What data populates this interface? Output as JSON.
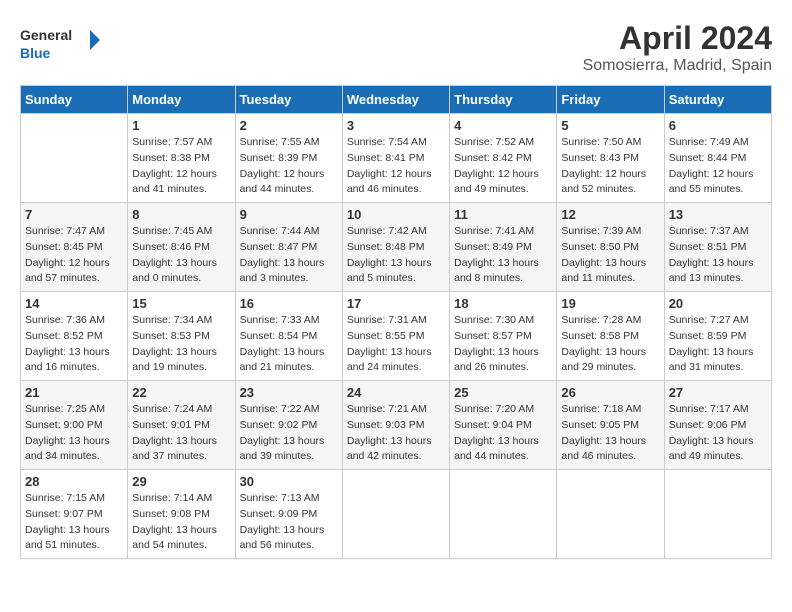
{
  "logo": {
    "line1": "General",
    "line2": "Blue"
  },
  "title": "April 2024",
  "subtitle": "Somosierra, Madrid, Spain",
  "days_of_week": [
    "Sunday",
    "Monday",
    "Tuesday",
    "Wednesday",
    "Thursday",
    "Friday",
    "Saturday"
  ],
  "weeks": [
    [
      {
        "day": "",
        "info": ""
      },
      {
        "day": "1",
        "info": "Sunrise: 7:57 AM\nSunset: 8:38 PM\nDaylight: 12 hours\nand 41 minutes."
      },
      {
        "day": "2",
        "info": "Sunrise: 7:55 AM\nSunset: 8:39 PM\nDaylight: 12 hours\nand 44 minutes."
      },
      {
        "day": "3",
        "info": "Sunrise: 7:54 AM\nSunset: 8:41 PM\nDaylight: 12 hours\nand 46 minutes."
      },
      {
        "day": "4",
        "info": "Sunrise: 7:52 AM\nSunset: 8:42 PM\nDaylight: 12 hours\nand 49 minutes."
      },
      {
        "day": "5",
        "info": "Sunrise: 7:50 AM\nSunset: 8:43 PM\nDaylight: 12 hours\nand 52 minutes."
      },
      {
        "day": "6",
        "info": "Sunrise: 7:49 AM\nSunset: 8:44 PM\nDaylight: 12 hours\nand 55 minutes."
      }
    ],
    [
      {
        "day": "7",
        "info": "Sunrise: 7:47 AM\nSunset: 8:45 PM\nDaylight: 12 hours\nand 57 minutes."
      },
      {
        "day": "8",
        "info": "Sunrise: 7:45 AM\nSunset: 8:46 PM\nDaylight: 13 hours\nand 0 minutes."
      },
      {
        "day": "9",
        "info": "Sunrise: 7:44 AM\nSunset: 8:47 PM\nDaylight: 13 hours\nand 3 minutes."
      },
      {
        "day": "10",
        "info": "Sunrise: 7:42 AM\nSunset: 8:48 PM\nDaylight: 13 hours\nand 5 minutes."
      },
      {
        "day": "11",
        "info": "Sunrise: 7:41 AM\nSunset: 8:49 PM\nDaylight: 13 hours\nand 8 minutes."
      },
      {
        "day": "12",
        "info": "Sunrise: 7:39 AM\nSunset: 8:50 PM\nDaylight: 13 hours\nand 11 minutes."
      },
      {
        "day": "13",
        "info": "Sunrise: 7:37 AM\nSunset: 8:51 PM\nDaylight: 13 hours\nand 13 minutes."
      }
    ],
    [
      {
        "day": "14",
        "info": "Sunrise: 7:36 AM\nSunset: 8:52 PM\nDaylight: 13 hours\nand 16 minutes."
      },
      {
        "day": "15",
        "info": "Sunrise: 7:34 AM\nSunset: 8:53 PM\nDaylight: 13 hours\nand 19 minutes."
      },
      {
        "day": "16",
        "info": "Sunrise: 7:33 AM\nSunset: 8:54 PM\nDaylight: 13 hours\nand 21 minutes."
      },
      {
        "day": "17",
        "info": "Sunrise: 7:31 AM\nSunset: 8:55 PM\nDaylight: 13 hours\nand 24 minutes."
      },
      {
        "day": "18",
        "info": "Sunrise: 7:30 AM\nSunset: 8:57 PM\nDaylight: 13 hours\nand 26 minutes."
      },
      {
        "day": "19",
        "info": "Sunrise: 7:28 AM\nSunset: 8:58 PM\nDaylight: 13 hours\nand 29 minutes."
      },
      {
        "day": "20",
        "info": "Sunrise: 7:27 AM\nSunset: 8:59 PM\nDaylight: 13 hours\nand 31 minutes."
      }
    ],
    [
      {
        "day": "21",
        "info": "Sunrise: 7:25 AM\nSunset: 9:00 PM\nDaylight: 13 hours\nand 34 minutes."
      },
      {
        "day": "22",
        "info": "Sunrise: 7:24 AM\nSunset: 9:01 PM\nDaylight: 13 hours\nand 37 minutes."
      },
      {
        "day": "23",
        "info": "Sunrise: 7:22 AM\nSunset: 9:02 PM\nDaylight: 13 hours\nand 39 minutes."
      },
      {
        "day": "24",
        "info": "Sunrise: 7:21 AM\nSunset: 9:03 PM\nDaylight: 13 hours\nand 42 minutes."
      },
      {
        "day": "25",
        "info": "Sunrise: 7:20 AM\nSunset: 9:04 PM\nDaylight: 13 hours\nand 44 minutes."
      },
      {
        "day": "26",
        "info": "Sunrise: 7:18 AM\nSunset: 9:05 PM\nDaylight: 13 hours\nand 46 minutes."
      },
      {
        "day": "27",
        "info": "Sunrise: 7:17 AM\nSunset: 9:06 PM\nDaylight: 13 hours\nand 49 minutes."
      }
    ],
    [
      {
        "day": "28",
        "info": "Sunrise: 7:15 AM\nSunset: 9:07 PM\nDaylight: 13 hours\nand 51 minutes."
      },
      {
        "day": "29",
        "info": "Sunrise: 7:14 AM\nSunset: 9:08 PM\nDaylight: 13 hours\nand 54 minutes."
      },
      {
        "day": "30",
        "info": "Sunrise: 7:13 AM\nSunset: 9:09 PM\nDaylight: 13 hours\nand 56 minutes."
      },
      {
        "day": "",
        "info": ""
      },
      {
        "day": "",
        "info": ""
      },
      {
        "day": "",
        "info": ""
      },
      {
        "day": "",
        "info": ""
      }
    ]
  ]
}
